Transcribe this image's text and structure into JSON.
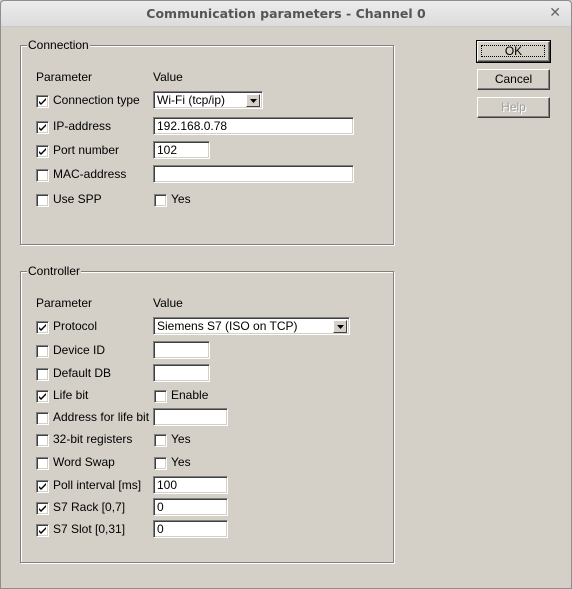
{
  "window": {
    "title": "Communication parameters - Channel 0",
    "close_icon": "close-icon"
  },
  "buttons": {
    "ok": "OK",
    "cancel": "Cancel",
    "help": "Help"
  },
  "connection": {
    "label": "Connection",
    "header_param": "Parameter",
    "header_value": "Value",
    "rows": [
      {
        "label": "Connection type",
        "checked": true,
        "value_type": "dropdown",
        "value": "Wi-Fi (tcp/ip)"
      },
      {
        "label": "IP-address",
        "checked": true,
        "value_type": "text",
        "value": "192.168.0.78"
      },
      {
        "label": "Port number",
        "checked": true,
        "value_type": "text",
        "value": "102"
      },
      {
        "label": "MAC-address",
        "checked": false,
        "value_type": "text",
        "value": ""
      },
      {
        "label": "Use SPP",
        "checked": false,
        "value_type": "checkbox",
        "value": "Yes",
        "value_checked": false
      }
    ]
  },
  "controller": {
    "label": "Controller",
    "header_param": "Parameter",
    "header_value": "Value",
    "rows": [
      {
        "label": "Protocol",
        "checked": true,
        "value_type": "dropdown",
        "value": "Siemens S7 (ISO on TCP)"
      },
      {
        "label": "Device ID",
        "checked": false,
        "value_type": "text",
        "value": ""
      },
      {
        "label": "Default DB",
        "checked": false,
        "value_type": "text",
        "value": ""
      },
      {
        "label": "Life bit",
        "checked": true,
        "value_type": "checkbox",
        "value": "Enable",
        "value_checked": false
      },
      {
        "label": "Address for life bit",
        "checked": false,
        "value_type": "text",
        "value": ""
      },
      {
        "label": "32-bit registers",
        "checked": false,
        "value_type": "checkbox",
        "value": "Yes",
        "value_checked": false
      },
      {
        "label": "Word Swap",
        "checked": false,
        "value_type": "checkbox",
        "value": "Yes",
        "value_checked": false
      },
      {
        "label": "Poll interval [ms]",
        "checked": true,
        "value_type": "text",
        "value": "100"
      },
      {
        "label": "S7 Rack [0,7]",
        "checked": true,
        "value_type": "text",
        "value": "0"
      },
      {
        "label": "S7 Slot [0,31]",
        "checked": true,
        "value_type": "text",
        "value": "0"
      }
    ]
  }
}
